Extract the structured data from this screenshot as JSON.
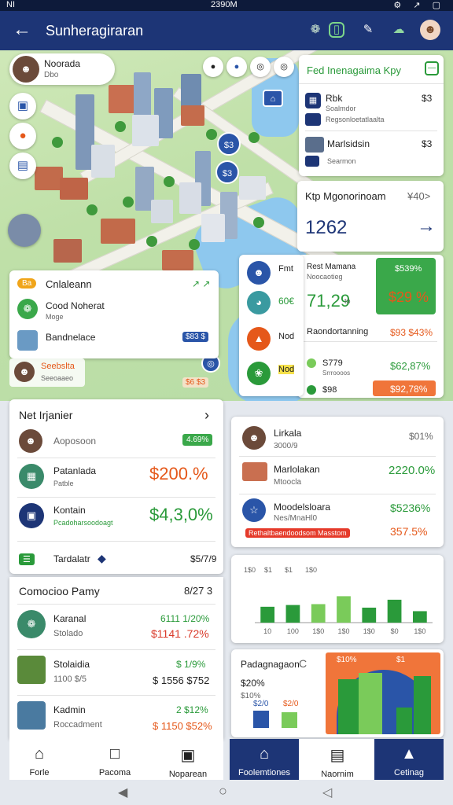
{
  "status": {
    "left": "NI",
    "time": "2390M",
    "right": "⚙ ↗ ▢"
  },
  "appbar": {
    "back": "←",
    "title": "Sunheragiraran",
    "icons": [
      "leaf-icon",
      "chat-icon",
      "edit-icon",
      "weather-icon",
      "avatar"
    ]
  },
  "map": {
    "pins": [
      "$3",
      "$3",
      "⌂"
    ],
    "pin_labels": [
      "◎",
      "◎",
      "◎"
    ],
    "top_icons": [
      "●",
      "●",
      "◎",
      "◎"
    ],
    "profile": {
      "name": "Noorada",
      "sub": "Dbo"
    },
    "left_buttons": [
      "▣",
      "●",
      "▤"
    ]
  },
  "right_panel": {
    "title": "Fed Inenagaima Kpy",
    "items": [
      {
        "name": "Rbk",
        "sub1": "Soalmdor",
        "sub2": "Regsonloetatlaalta",
        "price": "$3"
      },
      {
        "name": "Marlsidsin",
        "sub1": "Searmon",
        "price": "$3"
      }
    ]
  },
  "mid_right": {
    "title": "Ktp Mgonorinoam",
    "title_value": "¥40>",
    "big": "1262",
    "arrow": "→"
  },
  "stats": {
    "left_label": "Rest Mamana",
    "left_sub": "Noocaotieg",
    "left_value": "71,29",
    "left_suffix": "to",
    "green_top": "$539%",
    "green_big": "$29 %",
    "row_label": "Raondortanning",
    "row_value": "$93 $43%",
    "sub_rows": [
      {
        "name": "S779",
        "sub": "Srrroooos",
        "value": "$62,87%"
      },
      {
        "name": "$98",
        "sub": "",
        "value": "$92,78%"
      }
    ]
  },
  "side_list": [
    {
      "label": "Fmt",
      "value": ""
    },
    {
      "label": "60€",
      "value": ""
    },
    {
      "label": "Nod",
      "value": ""
    },
    {
      "label": "Nod",
      "value": ""
    }
  ],
  "legend_card": {
    "badge": "Ba",
    "title": "Cnlaleann",
    "arrows": "↗ ↗",
    "rows": [
      {
        "name": "Cood Noherat",
        "sub": "Moge"
      },
      {
        "name": "Bandnelace",
        "sub": "",
        "tag": "$83 $"
      }
    ]
  },
  "bottom_row_map": {
    "name": "Seebslta",
    "sub": "Seeoaaeo",
    "tag": "$6 $3"
  },
  "left_card": {
    "title": "Net Irjanier",
    "chev": "›",
    "rows": [
      {
        "name": "Aoposoon",
        "sub": "",
        "value": "4.69%",
        "vcolor": "green"
      },
      {
        "name": "Patanlada",
        "sub": "Patble",
        "value": "$200.%",
        "vcolor": "orange"
      },
      {
        "name": "Kontain",
        "sub": "Pcadoharsoodoagt",
        "value": "$4,3,0%",
        "vcolor": "green"
      }
    ],
    "footer_icon": "☰",
    "footer_name": "Tardalatr",
    "footer_value": "$5/7/9"
  },
  "left_card2": {
    "title": "Comocioo Pamy",
    "value": "8/27 3",
    "rows": [
      {
        "name": "Karanal",
        "sub": "Stolado",
        "v1": "6111 1/20%",
        "v2": "$1141 .72%"
      },
      {
        "name": "Stolaidia",
        "sub": "1100 $/5",
        "v1": "$ 1/9%",
        "v2": "$ 1556 $752"
      },
      {
        "name": "Kadmin",
        "sub": "Roccadment",
        "v1": "2 $12%",
        "v2": "$ 1150 $52%"
      }
    ]
  },
  "right_card": {
    "rows": [
      {
        "name": "Lirkala",
        "sub": "3000/9",
        "value": "$01%",
        "vcolor": "grey"
      },
      {
        "name": "Marlolakan",
        "sub": "Mtoocla",
        "value": "2220.0%",
        "vcolor": "green"
      },
      {
        "name": "Moodelsloara",
        "sub": "Nes/MnaHl0",
        "value": "$5236%",
        "vcolor": "green"
      },
      {
        "name": "",
        "sub": "",
        "value": "357.5%",
        "vcolor": "orange",
        "tag": "Rethaltbaendoodsom Masstom"
      }
    ]
  },
  "chart_data": {
    "type": "bar",
    "categories": [
      "10",
      "100",
      "1$0",
      "1$0",
      "1$0",
      "$0",
      "1$0"
    ],
    "values": [
      36,
      40,
      42,
      60,
      34,
      52,
      26
    ],
    "ylim": [
      0,
      100
    ],
    "legend": [
      "1$0",
      "$1",
      "$1",
      "1$0"
    ],
    "colors": [
      "#2a9a3a",
      "#2a9a3a",
      "#7acb5a",
      "#7acb5a",
      "#2a9a3a",
      "#2a9a3a",
      "#2a9a3a"
    ]
  },
  "bottom_chart": {
    "title": "Padagnagaon",
    "refresh": "C",
    "left_value": "$20%",
    "left_sub": "$10%",
    "blue": "$2/0",
    "orange": "$2/0",
    "chart_labels": [
      "$10%",
      "$1"
    ]
  },
  "nav_left": [
    {
      "icon": "⌂",
      "label": "Forle"
    },
    {
      "icon": "□",
      "label": "Pacoma"
    },
    {
      "icon": "▣",
      "label": "Noparean"
    }
  ],
  "nav_right": [
    {
      "icon": "⌂",
      "label": "Foolemtiones"
    },
    {
      "icon": "▤",
      "label": "Naornim"
    },
    {
      "icon": "▲",
      "label": "Cetinag"
    }
  ],
  "sysnav": [
    "◀",
    "○",
    "◁"
  ]
}
